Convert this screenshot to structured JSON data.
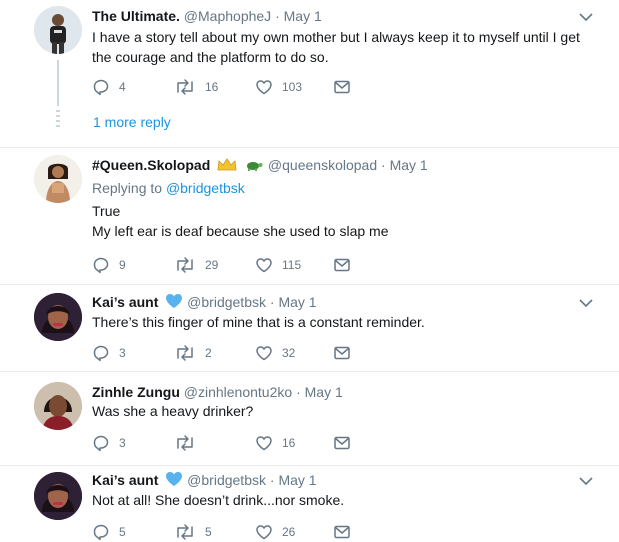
{
  "tweets": [
    {
      "name": "The Ultimate.",
      "handle": "@MaphopheJ",
      "sep": "·",
      "date": "May 1",
      "lines": [
        "I have a story tell about my own mother but I always keep it to myself until I get",
        "the courage and the platform to do so."
      ],
      "reply_count": "4",
      "retweet_count": "16",
      "like_count": "103"
    },
    {
      "name": "#Queen.Skolopad",
      "handle": "@queenskolopad",
      "sep": "·",
      "date": "May 1",
      "replying_label": "Replying to",
      "replying_to": "@bridgetbsk",
      "lines": [
        "True",
        "My left ear is deaf because she used to slap me"
      ],
      "reply_count": "9",
      "retweet_count": "29",
      "like_count": "115"
    },
    {
      "name": "Kai’s aunt",
      "handle": "@bridgetbsk",
      "sep": "·",
      "date": "May 1",
      "lines": [
        "There’s this finger of mine that is a constant reminder."
      ],
      "reply_count": "3",
      "retweet_count": "2",
      "like_count": "32"
    },
    {
      "name": "Zinhle Zungu",
      "handle": "@zinhlenontu2ko",
      "sep": "·",
      "date": "May 1",
      "lines": [
        "Was she a heavy drinker?"
      ],
      "reply_count": "3",
      "retweet_count": "",
      "like_count": "16"
    },
    {
      "name": "Kai’s aunt",
      "handle": "@bridgetbsk",
      "sep": "·",
      "date": "May 1",
      "lines": [
        "Not at all! She doesn’t drink...nor smoke."
      ],
      "reply_count": "5",
      "retweet_count": "5",
      "like_count": "26"
    }
  ],
  "thread": {
    "more_reply_label": "1 more reply"
  },
  "colors": {
    "accent": "#1b95e0",
    "muted": "#657786",
    "divider": "#e6ecf0",
    "heart_badge": "#58b2ee",
    "crown": "#f4c430",
    "turtle": "#3a8a3a"
  },
  "icons": {
    "reply": "reply-icon",
    "retweet": "retweet-icon",
    "like": "heart-icon",
    "dm": "direct-message-icon",
    "more": "chevron-down-icon"
  }
}
